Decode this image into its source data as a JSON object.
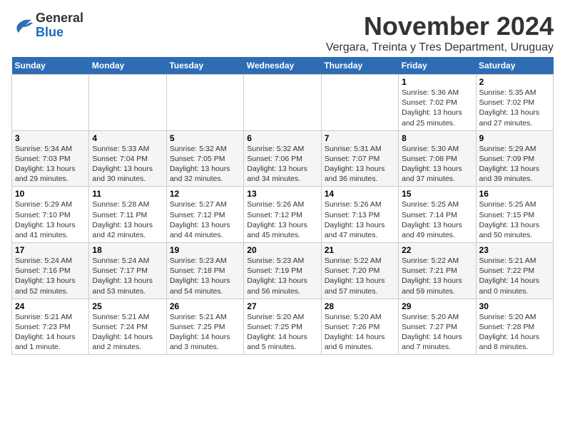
{
  "logo": {
    "general": "General",
    "blue": "Blue"
  },
  "title": "November 2024",
  "subtitle": "Vergara, Treinta y Tres Department, Uruguay",
  "weekdays": [
    "Sunday",
    "Monday",
    "Tuesday",
    "Wednesday",
    "Thursday",
    "Friday",
    "Saturday"
  ],
  "weeks": [
    [
      {
        "day": "",
        "info": ""
      },
      {
        "day": "",
        "info": ""
      },
      {
        "day": "",
        "info": ""
      },
      {
        "day": "",
        "info": ""
      },
      {
        "day": "",
        "info": ""
      },
      {
        "day": "1",
        "info": "Sunrise: 5:36 AM\nSunset: 7:02 PM\nDaylight: 13 hours\nand 25 minutes."
      },
      {
        "day": "2",
        "info": "Sunrise: 5:35 AM\nSunset: 7:02 PM\nDaylight: 13 hours\nand 27 minutes."
      }
    ],
    [
      {
        "day": "3",
        "info": "Sunrise: 5:34 AM\nSunset: 7:03 PM\nDaylight: 13 hours\nand 29 minutes."
      },
      {
        "day": "4",
        "info": "Sunrise: 5:33 AM\nSunset: 7:04 PM\nDaylight: 13 hours\nand 30 minutes."
      },
      {
        "day": "5",
        "info": "Sunrise: 5:32 AM\nSunset: 7:05 PM\nDaylight: 13 hours\nand 32 minutes."
      },
      {
        "day": "6",
        "info": "Sunrise: 5:32 AM\nSunset: 7:06 PM\nDaylight: 13 hours\nand 34 minutes."
      },
      {
        "day": "7",
        "info": "Sunrise: 5:31 AM\nSunset: 7:07 PM\nDaylight: 13 hours\nand 36 minutes."
      },
      {
        "day": "8",
        "info": "Sunrise: 5:30 AM\nSunset: 7:08 PM\nDaylight: 13 hours\nand 37 minutes."
      },
      {
        "day": "9",
        "info": "Sunrise: 5:29 AM\nSunset: 7:09 PM\nDaylight: 13 hours\nand 39 minutes."
      }
    ],
    [
      {
        "day": "10",
        "info": "Sunrise: 5:29 AM\nSunset: 7:10 PM\nDaylight: 13 hours\nand 41 minutes."
      },
      {
        "day": "11",
        "info": "Sunrise: 5:28 AM\nSunset: 7:11 PM\nDaylight: 13 hours\nand 42 minutes."
      },
      {
        "day": "12",
        "info": "Sunrise: 5:27 AM\nSunset: 7:12 PM\nDaylight: 13 hours\nand 44 minutes."
      },
      {
        "day": "13",
        "info": "Sunrise: 5:26 AM\nSunset: 7:12 PM\nDaylight: 13 hours\nand 45 minutes."
      },
      {
        "day": "14",
        "info": "Sunrise: 5:26 AM\nSunset: 7:13 PM\nDaylight: 13 hours\nand 47 minutes."
      },
      {
        "day": "15",
        "info": "Sunrise: 5:25 AM\nSunset: 7:14 PM\nDaylight: 13 hours\nand 49 minutes."
      },
      {
        "day": "16",
        "info": "Sunrise: 5:25 AM\nSunset: 7:15 PM\nDaylight: 13 hours\nand 50 minutes."
      }
    ],
    [
      {
        "day": "17",
        "info": "Sunrise: 5:24 AM\nSunset: 7:16 PM\nDaylight: 13 hours\nand 52 minutes."
      },
      {
        "day": "18",
        "info": "Sunrise: 5:24 AM\nSunset: 7:17 PM\nDaylight: 13 hours\nand 53 minutes."
      },
      {
        "day": "19",
        "info": "Sunrise: 5:23 AM\nSunset: 7:18 PM\nDaylight: 13 hours\nand 54 minutes."
      },
      {
        "day": "20",
        "info": "Sunrise: 5:23 AM\nSunset: 7:19 PM\nDaylight: 13 hours\nand 56 minutes."
      },
      {
        "day": "21",
        "info": "Sunrise: 5:22 AM\nSunset: 7:20 PM\nDaylight: 13 hours\nand 57 minutes."
      },
      {
        "day": "22",
        "info": "Sunrise: 5:22 AM\nSunset: 7:21 PM\nDaylight: 13 hours\nand 59 minutes."
      },
      {
        "day": "23",
        "info": "Sunrise: 5:21 AM\nSunset: 7:22 PM\nDaylight: 14 hours\nand 0 minutes."
      }
    ],
    [
      {
        "day": "24",
        "info": "Sunrise: 5:21 AM\nSunset: 7:23 PM\nDaylight: 14 hours\nand 1 minute."
      },
      {
        "day": "25",
        "info": "Sunrise: 5:21 AM\nSunset: 7:24 PM\nDaylight: 14 hours\nand 2 minutes."
      },
      {
        "day": "26",
        "info": "Sunrise: 5:21 AM\nSunset: 7:25 PM\nDaylight: 14 hours\nand 3 minutes."
      },
      {
        "day": "27",
        "info": "Sunrise: 5:20 AM\nSunset: 7:25 PM\nDaylight: 14 hours\nand 5 minutes."
      },
      {
        "day": "28",
        "info": "Sunrise: 5:20 AM\nSunset: 7:26 PM\nDaylight: 14 hours\nand 6 minutes."
      },
      {
        "day": "29",
        "info": "Sunrise: 5:20 AM\nSunset: 7:27 PM\nDaylight: 14 hours\nand 7 minutes."
      },
      {
        "day": "30",
        "info": "Sunrise: 5:20 AM\nSunset: 7:28 PM\nDaylight: 14 hours\nand 8 minutes."
      }
    ]
  ]
}
